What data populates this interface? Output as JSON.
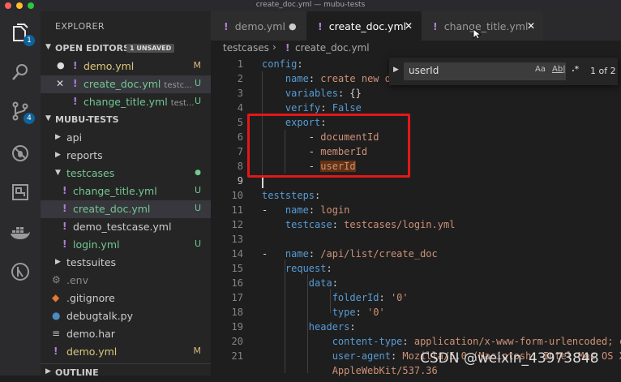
{
  "window_title": "create_doc.yml — mubu-tests",
  "activity": {
    "explorer_badge": "1",
    "scm_badge": "4"
  },
  "sidebar": {
    "title": "EXPLORER",
    "open_editors": {
      "label": "OPEN EDITORS",
      "unsaved": "1 UNSAVED",
      "items": [
        {
          "name": "demo.yml",
          "path": "",
          "status": "M"
        },
        {
          "name": "create_doc.yml",
          "path": "testc...",
          "status": "U"
        },
        {
          "name": "change_title.yml",
          "path": "test...",
          "status": "U"
        }
      ]
    },
    "project": {
      "label": "MUBU-TESTS",
      "items": [
        {
          "name": "api",
          "status": ""
        },
        {
          "name": "reports",
          "status": ""
        },
        {
          "name": "testcases",
          "status": "●"
        },
        {
          "name": "change_title.yml",
          "status": "U"
        },
        {
          "name": "create_doc.yml",
          "status": "U"
        },
        {
          "name": "demo_testcase.yml",
          "status": ""
        },
        {
          "name": "login.yml",
          "status": "U"
        },
        {
          "name": "testsuites",
          "status": ""
        },
        {
          "name": ".env",
          "status": ""
        },
        {
          "name": ".gitignore",
          "status": ""
        },
        {
          "name": "debugtalk.py",
          "status": ""
        },
        {
          "name": "demo.har",
          "status": ""
        },
        {
          "name": "demo.yml",
          "status": "M"
        }
      ]
    },
    "outline": "OUTLINE"
  },
  "tabs": [
    {
      "label": "demo.yml",
      "indicator": "●"
    },
    {
      "label": "create_doc.yml",
      "indicator": "✕"
    },
    {
      "label": "change_title.yml",
      "indicator": "✕"
    }
  ],
  "breadcrumb": {
    "folder": "testcases",
    "sep": "›",
    "file": "create_doc.yml"
  },
  "find": {
    "value": "userId",
    "opt_case": "Aa",
    "opt_word": "Ab|",
    "opt_regex": ".*",
    "count": "1 of 2"
  },
  "line_numbers": [
    "1",
    "2",
    "3",
    "4",
    "5",
    "6",
    "7",
    "8",
    "9",
    "10",
    "11",
    "12",
    "13",
    "14",
    "15",
    "16",
    "17",
    "18",
    "19",
    "20",
    "21"
  ],
  "code": {
    "l1k": "config",
    "l1p": ":",
    "l2k": "name",
    "l2v": "create new d",
    "l3k": "variables",
    "l3v": "{}",
    "l4k": "verify",
    "l4v": "False",
    "l5k": "export",
    "l6": "documentId",
    "l7": "memberId",
    "l8": "userId",
    "l10k": "teststeps",
    "l11k": "name",
    "l11v": "login",
    "l12k": "testcase",
    "l12v": "testcases/login.yml",
    "l14k": "name",
    "l14v": "/api/list/create_doc",
    "l15k": "request",
    "l16k": "data",
    "l17k": "folderId",
    "l17v": "'0'",
    "l18k": "type",
    "l18v": "'0'",
    "l19k": "headers",
    "l20k": "content-type",
    "l20v": "application/x-www-form-urlencoded; cha",
    "l21k": "user-agent",
    "l21v": "Mozilla/5.0 (Macintosh; Intel Mac OS X 1",
    "l21b": "AppleWebKit/537.36"
  },
  "watermark": "CSDN @weixin_43973848"
}
